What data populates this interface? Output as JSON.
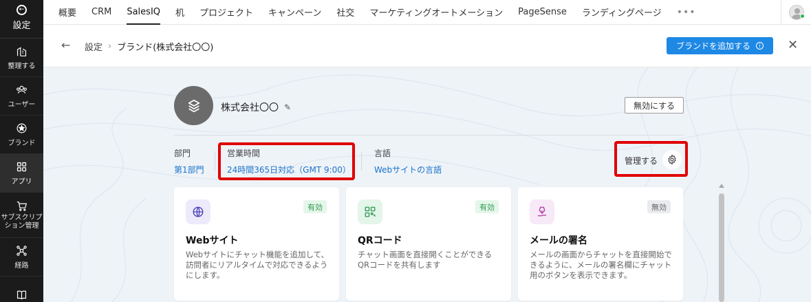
{
  "sidebar": {
    "title": "設定",
    "items": [
      {
        "label": "整理する",
        "icon": "building-icon"
      },
      {
        "label": "ユーザー",
        "icon": "users-icon"
      },
      {
        "label": "ブランド",
        "icon": "brand-star-icon"
      },
      {
        "label": "アプリ",
        "icon": "apps-grid-icon",
        "active": true
      },
      {
        "label": "サブスクリプション管理",
        "line1": "サブスクリプ",
        "line2": "ション管理",
        "icon": "cart-icon"
      },
      {
        "label": "経路",
        "icon": "routing-icon"
      },
      {
        "label": "",
        "icon": "book-icon"
      }
    ]
  },
  "topnav": {
    "tabs": [
      "概要",
      "CRM",
      "SalesIQ",
      "机",
      "プロジェクト",
      "キャンペーン",
      "社交",
      "マーケティングオートメーション",
      "PageSense",
      "ランディングページ"
    ],
    "active_tab": "SalesIQ",
    "more": "•••"
  },
  "header": {
    "breadcrumb_root": "設定",
    "breadcrumb_current": "ブランド(株式会社〇〇)",
    "add_brand_label": "ブランドを追加する",
    "info_glyph": "i"
  },
  "brand": {
    "name": "株式会社〇〇",
    "disable_label": "無効にする"
  },
  "meta": {
    "department_label": "部門",
    "department_value": "第1部門",
    "hours_label": "営業時間",
    "hours_value": "24時間365日対応（GMT 9:00）",
    "language_label": "言語",
    "language_value": "Webサイトの言語",
    "manage_label": "管理する"
  },
  "cards": [
    {
      "title": "Webサイト",
      "status": "有効",
      "enabled": true,
      "icon": "globe-icon",
      "description": "Webサイトにチャット機能を追加して、訪問者にリアルタイムで対応できるようにします。"
    },
    {
      "title": "QRコード",
      "status": "有効",
      "enabled": true,
      "icon": "qr-code-icon",
      "description": "チャット画面を直接開くことができるQRコードを共有します"
    },
    {
      "title": "メールの署名",
      "status": "無効",
      "enabled": false,
      "icon": "pen-signature-icon",
      "description": "メールの画面からチャットを直接開始できるように、メールの署名欄にチャット用のボタンを表示できます。"
    }
  ],
  "colors": {
    "primary": "#1e88e5",
    "link": "#1a73c9",
    "highlight_box": "#e00000",
    "sidebar_bg": "#1b1b1b",
    "enabled_badge": "#2e9b52"
  }
}
